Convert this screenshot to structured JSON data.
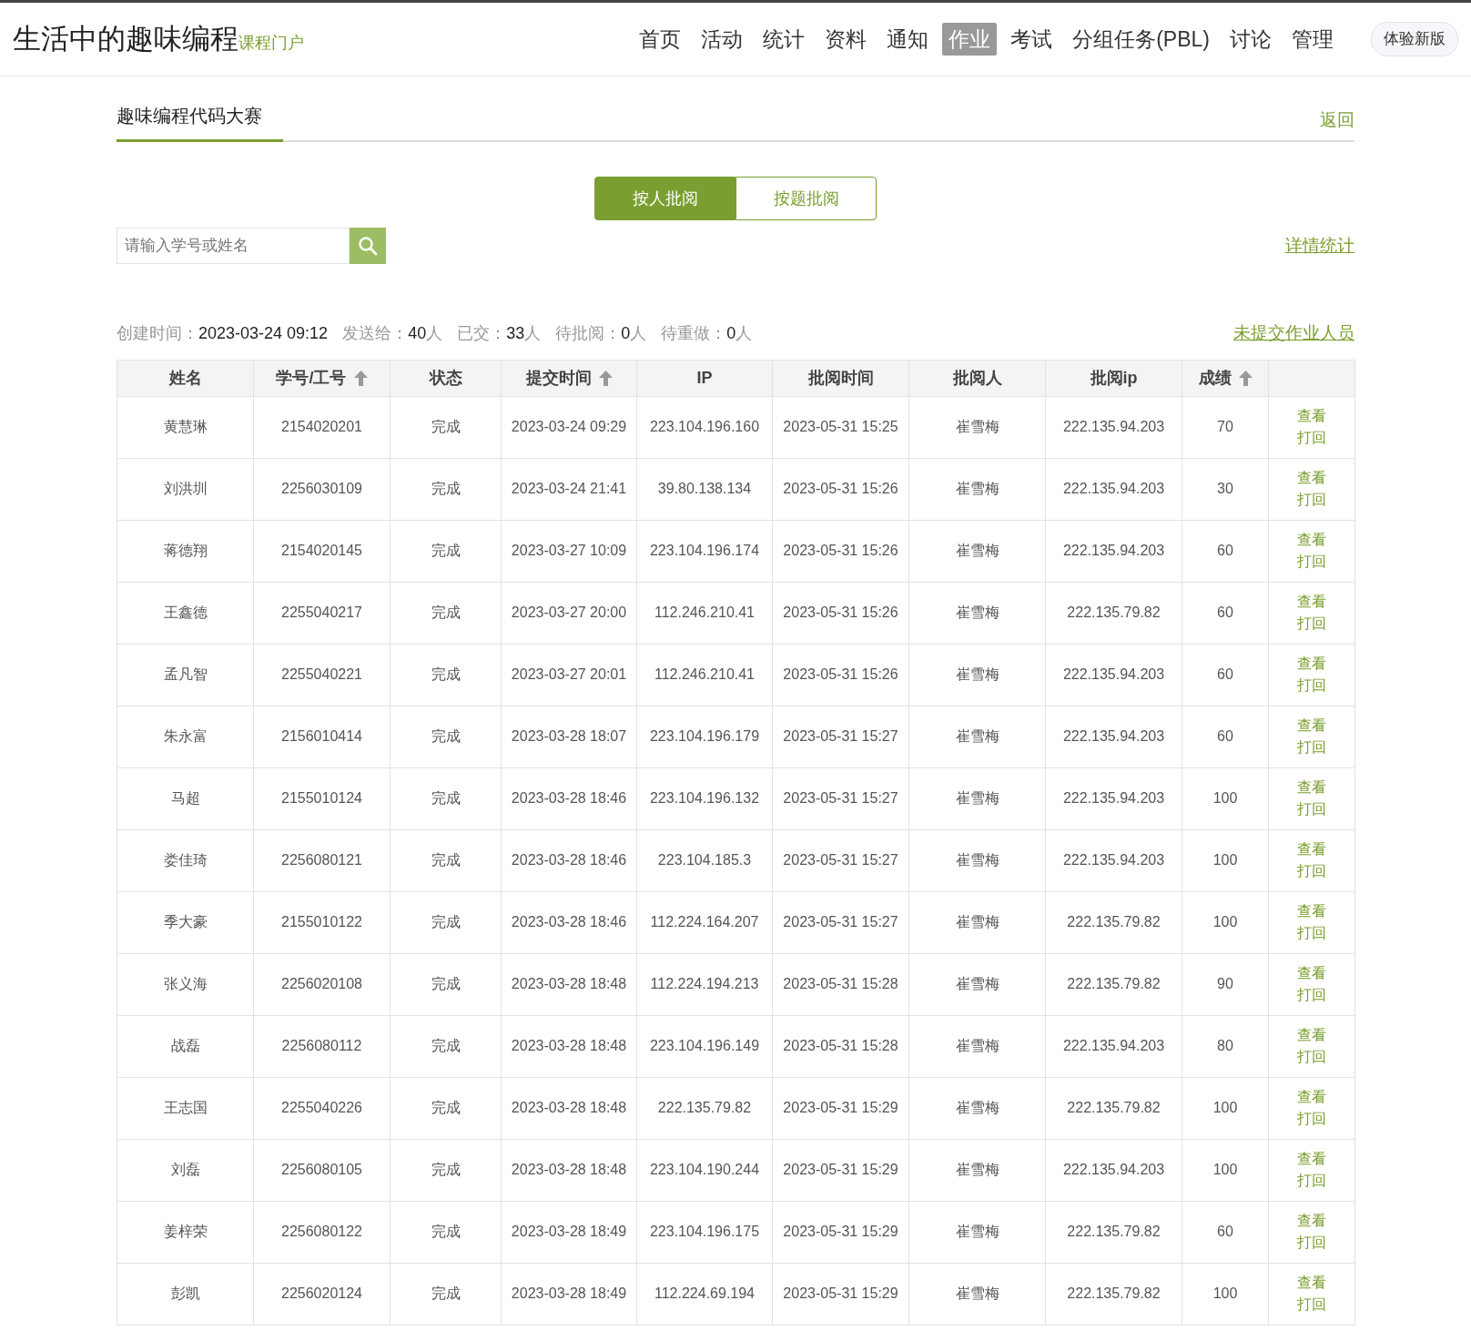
{
  "header": {
    "title": "生活中的趣味编程",
    "subtitle": "课程门户",
    "nav": [
      {
        "label": "首页",
        "selected": false
      },
      {
        "label": "活动",
        "selected": false
      },
      {
        "label": "统计",
        "selected": false
      },
      {
        "label": "资料",
        "selected": false
      },
      {
        "label": "通知",
        "selected": false
      },
      {
        "label": "作业",
        "selected": true
      },
      {
        "label": "考试",
        "selected": false
      },
      {
        "label": "分组任务(PBL)",
        "selected": false
      },
      {
        "label": "讨论",
        "selected": false
      },
      {
        "label": "管理",
        "selected": false
      }
    ],
    "new_version_button": "体验新版"
  },
  "page_tab": "趣味编程代码大赛",
  "back_link": "返回",
  "mode_tabs": [
    {
      "label": "按人批阅",
      "selected": true
    },
    {
      "label": "按题批阅",
      "selected": false
    }
  ],
  "search": {
    "placeholder": "请输入学号或姓名"
  },
  "detail_stats_link": "详情统计",
  "stats": [
    {
      "label": "创建时间：",
      "value": "2023-03-24 09:12"
    },
    {
      "label": "发送给：",
      "value": "40",
      "unit": "人"
    },
    {
      "label": "已交：",
      "value": "33",
      "unit": "人"
    },
    {
      "label": "待批阅：",
      "value": "0",
      "unit": "人"
    },
    {
      "label": "待重做：",
      "value": "0",
      "unit": "人"
    }
  ],
  "unsubmitted_link": "未提交作业人员",
  "table": {
    "columns": [
      {
        "label": "姓名",
        "sortable": false
      },
      {
        "label": "学号/工号",
        "sortable": true
      },
      {
        "label": "状态",
        "sortable": false
      },
      {
        "label": "提交时间",
        "sortable": true
      },
      {
        "label": "IP",
        "sortable": false
      },
      {
        "label": "批阅时间",
        "sortable": false
      },
      {
        "label": "批阅人",
        "sortable": false
      },
      {
        "label": "批阅ip",
        "sortable": false
      },
      {
        "label": "成绩",
        "sortable": true
      }
    ],
    "rows": [
      {
        "cells": [
          "黄慧琳",
          "2154020201",
          "完成",
          "2023-03-24 09:29",
          "223.104.196.160",
          "2023-05-31 15:25",
          "崔雪梅",
          "222.135.94.203",
          "70"
        ],
        "actions": [
          "查看",
          "打回"
        ]
      },
      {
        "cells": [
          "刘洪圳",
          "2256030109",
          "完成",
          "2023-03-24 21:41",
          "39.80.138.134",
          "2023-05-31 15:26",
          "崔雪梅",
          "222.135.94.203",
          "30"
        ],
        "actions": [
          "查看",
          "打回"
        ]
      },
      {
        "cells": [
          "蒋德翔",
          "2154020145",
          "完成",
          "2023-03-27 10:09",
          "223.104.196.174",
          "2023-05-31 15:26",
          "崔雪梅",
          "222.135.94.203",
          "60"
        ],
        "actions": [
          "查看",
          "打回"
        ]
      },
      {
        "cells": [
          "王鑫德",
          "2255040217",
          "完成",
          "2023-03-27 20:00",
          "112.246.210.41",
          "2023-05-31 15:26",
          "崔雪梅",
          "222.135.79.82",
          "60"
        ],
        "actions": [
          "查看",
          "打回"
        ]
      },
      {
        "cells": [
          "孟凡智",
          "2255040221",
          "完成",
          "2023-03-27 20:01",
          "112.246.210.41",
          "2023-05-31 15:26",
          "崔雪梅",
          "222.135.94.203",
          "60"
        ],
        "actions": [
          "查看",
          "打回"
        ]
      },
      {
        "cells": [
          "朱永富",
          "2156010414",
          "完成",
          "2023-03-28 18:07",
          "223.104.196.179",
          "2023-05-31 15:27",
          "崔雪梅",
          "222.135.94.203",
          "60"
        ],
        "actions": [
          "查看",
          "打回"
        ]
      },
      {
        "cells": [
          "马超",
          "2155010124",
          "完成",
          "2023-03-28 18:46",
          "223.104.196.132",
          "2023-05-31 15:27",
          "崔雪梅",
          "222.135.94.203",
          "100"
        ],
        "actions": [
          "查看",
          "打回"
        ]
      },
      {
        "cells": [
          "娄佳琦",
          "2256080121",
          "完成",
          "2023-03-28 18:46",
          "223.104.185.3",
          "2023-05-31 15:27",
          "崔雪梅",
          "222.135.94.203",
          "100"
        ],
        "actions": [
          "查看",
          "打回"
        ]
      },
      {
        "cells": [
          "季大豪",
          "2155010122",
          "完成",
          "2023-03-28 18:46",
          "112.224.164.207",
          "2023-05-31 15:27",
          "崔雪梅",
          "222.135.79.82",
          "100"
        ],
        "actions": [
          "查看",
          "打回"
        ]
      },
      {
        "cells": [
          "张义海",
          "2256020108",
          "完成",
          "2023-03-28 18:48",
          "112.224.194.213",
          "2023-05-31 15:28",
          "崔雪梅",
          "222.135.79.82",
          "90"
        ],
        "actions": [
          "查看",
          "打回"
        ]
      },
      {
        "cells": [
          "战磊",
          "2256080112",
          "完成",
          "2023-03-28 18:48",
          "223.104.196.149",
          "2023-05-31 15:28",
          "崔雪梅",
          "222.135.94.203",
          "80"
        ],
        "actions": [
          "查看",
          "打回"
        ]
      },
      {
        "cells": [
          "王志国",
          "2255040226",
          "完成",
          "2023-03-28 18:48",
          "222.135.79.82",
          "2023-05-31 15:29",
          "崔雪梅",
          "222.135.79.82",
          "100"
        ],
        "actions": [
          "查看",
          "打回"
        ]
      },
      {
        "cells": [
          "刘磊",
          "2256080105",
          "完成",
          "2023-03-28 18:48",
          "223.104.190.244",
          "2023-05-31 15:29",
          "崔雪梅",
          "222.135.94.203",
          "100"
        ],
        "actions": [
          "查看",
          "打回"
        ]
      },
      {
        "cells": [
          "姜梓荣",
          "2256080122",
          "完成",
          "2023-03-28 18:49",
          "223.104.196.175",
          "2023-05-31 15:29",
          "崔雪梅",
          "222.135.79.82",
          "60"
        ],
        "actions": [
          "查看",
          "打回"
        ]
      },
      {
        "cells": [
          "彭凯",
          "2256020124",
          "完成",
          "2023-03-28 18:49",
          "112.224.69.194",
          "2023-05-31 15:29",
          "崔雪梅",
          "222.135.79.82",
          "100"
        ],
        "actions": [
          "查看",
          "打回"
        ]
      }
    ]
  }
}
